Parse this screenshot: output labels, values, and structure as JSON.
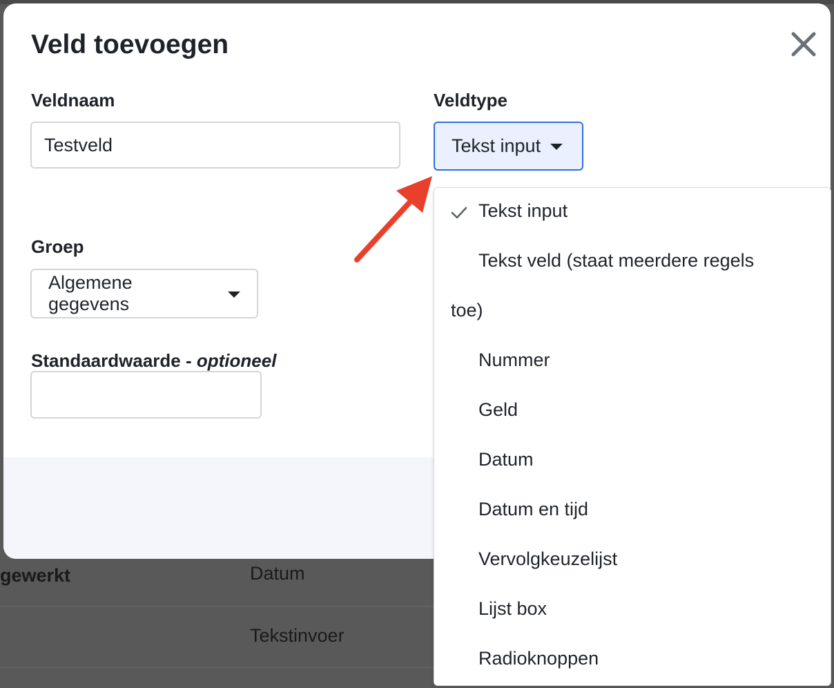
{
  "background": {
    "row1_label": "gewerkt",
    "row1_value": "Datum",
    "row2_value": "Tekstinvoer"
  },
  "modal": {
    "title": "Veld toevoegen",
    "field_name": {
      "label": "Veldnaam",
      "value": "Testveld"
    },
    "field_type": {
      "label": "Veldtype",
      "selected": "Tekst input"
    },
    "group": {
      "label": "Groep",
      "selected": "Algemene gegevens"
    },
    "default_value": {
      "label": "Standaardwaarde - ",
      "label_optional": "optioneel",
      "value": ""
    }
  },
  "dropdown": {
    "options": [
      "Tekst input",
      "Tekst veld (staat meerdere regels",
      "toe)",
      "Nummer",
      "Geld",
      "Datum",
      "Datum en tijd",
      "Vervolgkeuzelijst",
      "Lijst box",
      "Radioknoppen"
    ],
    "checked_index": 0
  },
  "icons": {
    "close": "close-icon",
    "check": "check-icon",
    "caret": "caret-down-icon",
    "annotation": "red-arrow-annotation"
  },
  "colors": {
    "accent": "#2f6de1",
    "accent_bg": "#eaf0fd",
    "arrow": "#e8402b"
  }
}
